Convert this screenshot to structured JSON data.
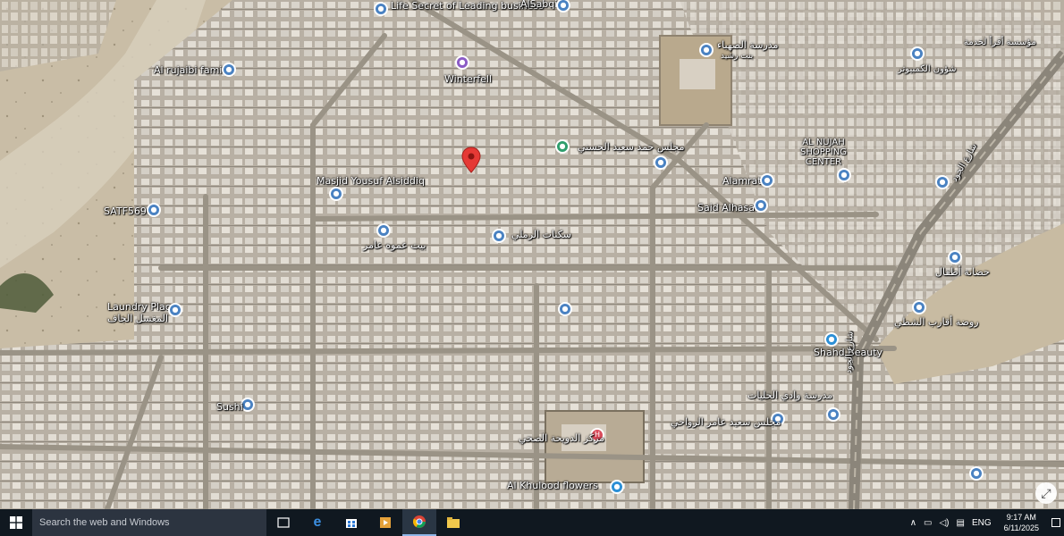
{
  "map": {
    "places": [
      {
        "name": "Life Secret of Leading business",
        "kind": "business"
      },
      {
        "name": "AlSabqi",
        "kind": "business"
      },
      {
        "name": "مدرسة الصهباء",
        "kind": "school"
      },
      {
        "name": "بنت رشيد",
        "kind": "school"
      },
      {
        "name": "مؤسسة أقرأ لخدمة",
        "kind": "business"
      },
      {
        "name": "شؤون الكمبيوتر",
        "kind": "business"
      },
      {
        "name": "Al rujaibi family",
        "kind": "business"
      },
      {
        "name": "Winterfell",
        "kind": "shopping"
      },
      {
        "name": "مجلس حمد سعيد الحسني",
        "kind": "business"
      },
      {
        "name": "AL NUJAH SHOPPING CENTER",
        "kind": "shopping"
      },
      {
        "name": "Alamrat",
        "kind": "business"
      },
      {
        "name": "Masjid Yousuf Alsiddiq",
        "kind": "mosque"
      },
      {
        "name": "SATF5690",
        "kind": "business"
      },
      {
        "name": "Said Alhasani",
        "kind": "business"
      },
      {
        "name": "سكنات الرملي",
        "kind": "business"
      },
      {
        "name": "بيت عموه عامر",
        "kind": "business"
      },
      {
        "name": "Laundry Place",
        "kind": "laundry"
      },
      {
        "name": "المغسل الجاف",
        "kind": "laundry"
      },
      {
        "name": "حضانة أطفال",
        "kind": "business"
      },
      {
        "name": "روضة أقارب الشطي",
        "kind": "school"
      },
      {
        "name": "Shahd Beauty",
        "kind": "beauty"
      },
      {
        "name": "مدرسة وادي الحليات",
        "kind": "school"
      },
      {
        "name": "مجلس سعيد عامر الرواحي",
        "kind": "business"
      },
      {
        "name": "مركز الدويحة الصحي",
        "kind": "health"
      },
      {
        "name": "Al Khulood flowers",
        "kind": "shopping"
      },
      {
        "name": "Sushi",
        "kind": "restaurant"
      },
      {
        "name": "شارع الجود",
        "kind": "road"
      }
    ],
    "marker_label": "selected-location",
    "expand_label": "⤢"
  },
  "taskbar": {
    "search_placeholder": "Search the web and Windows",
    "language": "ENG",
    "time": "9:17 AM",
    "date": "6/11/2025"
  }
}
